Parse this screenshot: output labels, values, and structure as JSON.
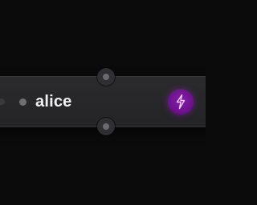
{
  "node": {
    "name": "alice",
    "icon": "lightning-bolt-icon"
  },
  "colors": {
    "background": "#0b0b0c",
    "card": "#2b2b2e",
    "badge": "#7a169c",
    "status_dot": "#6e6e74"
  }
}
